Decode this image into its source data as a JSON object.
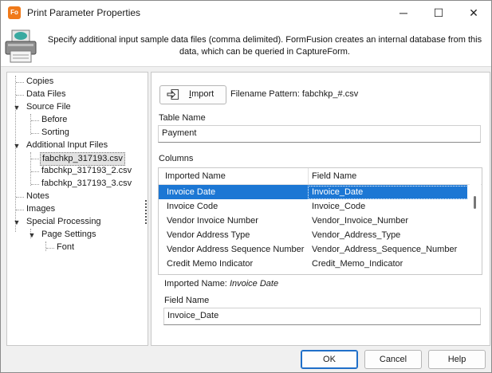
{
  "window": {
    "title": "Print Parameter Properties",
    "icon_text": "Fo",
    "controls": {
      "minimize": "─",
      "maximize": "☐",
      "close": "✕"
    }
  },
  "header": {
    "description": "Specify additional input sample data files (comma delimited). FormFusion creates an internal database from this data, which can be queried in CaptureForm."
  },
  "tree": {
    "items": [
      {
        "label": "Copies"
      },
      {
        "label": "Data Files"
      },
      {
        "label": "Source File",
        "expanded": true
      },
      {
        "label": "Before"
      },
      {
        "label": "Sorting"
      },
      {
        "label": "Additional Input Files",
        "expanded": true
      },
      {
        "label": "fabchkp_317193.csv",
        "selected": true
      },
      {
        "label": "fabchkp_317193_2.csv"
      },
      {
        "label": "fabchkp_317193_3.csv"
      },
      {
        "label": "Notes"
      },
      {
        "label": "Images"
      },
      {
        "label": "Special Processing",
        "expanded": true
      },
      {
        "label": "Page Settings",
        "expanded": true
      },
      {
        "label": "Font"
      }
    ]
  },
  "main": {
    "import_label": "Import",
    "import_accelerator": "I",
    "import_rest": "mport",
    "filename_pattern_label": "Filename Pattern:",
    "filename_pattern_value": "fabchkp_#.csv",
    "table_name_label": "Table Name",
    "table_name_value": "Payment",
    "columns_label": "Columns",
    "grid": {
      "headers": [
        "Imported Name",
        "Field Name"
      ],
      "rows": [
        {
          "imported": "Invoice Date",
          "field": "Invoice_Date",
          "selected": true
        },
        {
          "imported": "Invoice Code",
          "field": "Invoice_Code"
        },
        {
          "imported": "Vendor Invoice Number",
          "field": "Vendor_Invoice_Number"
        },
        {
          "imported": "Vendor Address Type",
          "field": "Vendor_Address_Type"
        },
        {
          "imported": "Vendor Address Sequence Number",
          "field": "Vendor_Address_Sequence_Number"
        },
        {
          "imported": "Credit Memo Indicator",
          "field": "Credit_Memo_Indicator"
        }
      ]
    },
    "imported_name_label": "Imported Name:",
    "imported_name_value": "Invoice Date",
    "field_name_label": "Field Name",
    "field_name_value": "Invoice_Date"
  },
  "footer": {
    "ok": "OK",
    "cancel": "Cancel",
    "help": "Help"
  },
  "colors": {
    "selection": "#1c77d4",
    "app_icon": "#f07a1a"
  }
}
